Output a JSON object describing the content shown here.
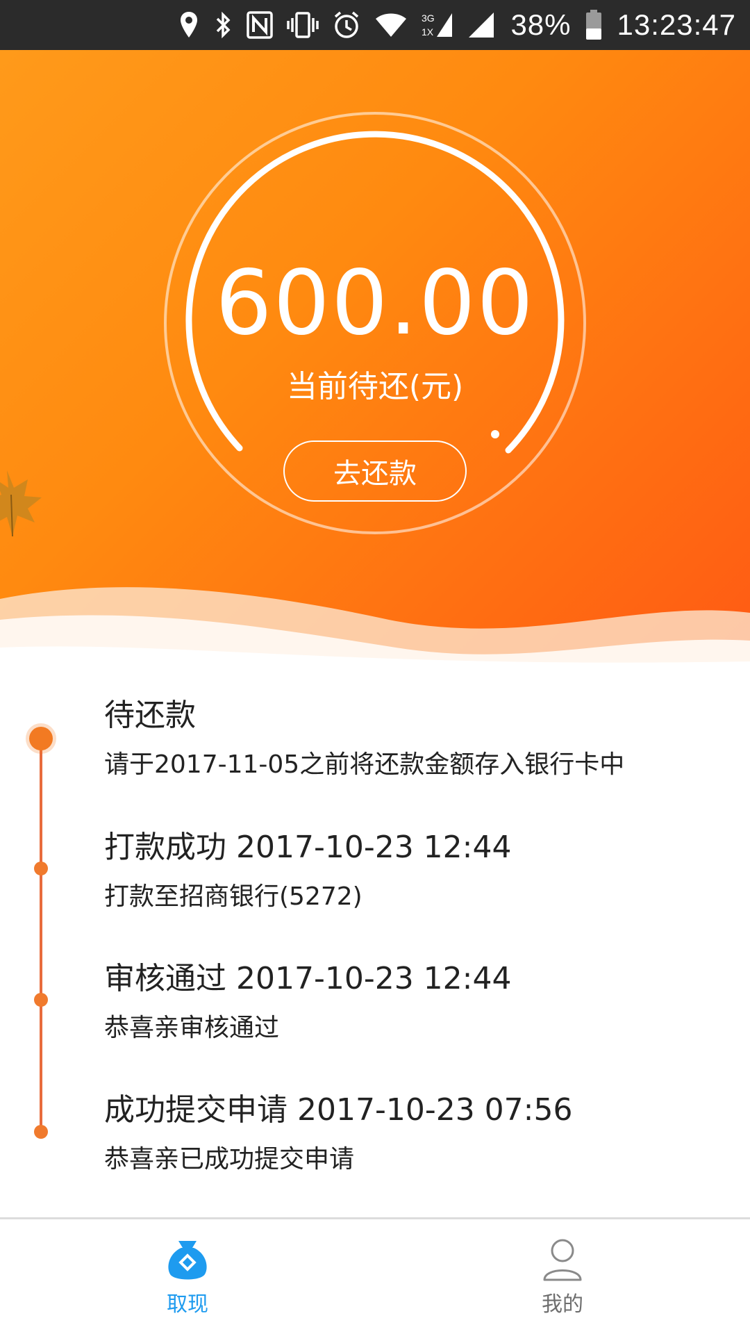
{
  "status_bar": {
    "battery": "38%",
    "time": "13:23:47",
    "network": "3G",
    "network_sub": "1X",
    "icons": [
      "location-icon",
      "bluetooth-icon",
      "nfc-icon",
      "vibrate-icon",
      "alarm-icon",
      "wifi-icon",
      "signal-3g-icon",
      "signal-icon",
      "battery-icon"
    ]
  },
  "hero": {
    "amount": "600.00",
    "amount_label": "当前待还(元)",
    "repay_button": "去还款"
  },
  "timeline": [
    {
      "title": "待还款",
      "desc": "请于2017-11-05之前将还款金额存入银行卡中",
      "active": true
    },
    {
      "title": "打款成功 2017-10-23 12:44",
      "desc": "打款至招商银行(5272)"
    },
    {
      "title": "审核通过 2017-10-23 12:44",
      "desc": "恭喜亲审核通过"
    },
    {
      "title": "成功提交申请 2017-10-23 07:56",
      "desc": "恭喜亲已成功提交申请"
    }
  ],
  "bottom_nav": {
    "withdraw": "取现",
    "mine": "我的"
  },
  "colors": {
    "accent_orange": "#ff7e14",
    "timeline_line": "#e86b3c",
    "nav_active": "#1e9bef",
    "nav_inactive": "#6e6e6e"
  }
}
